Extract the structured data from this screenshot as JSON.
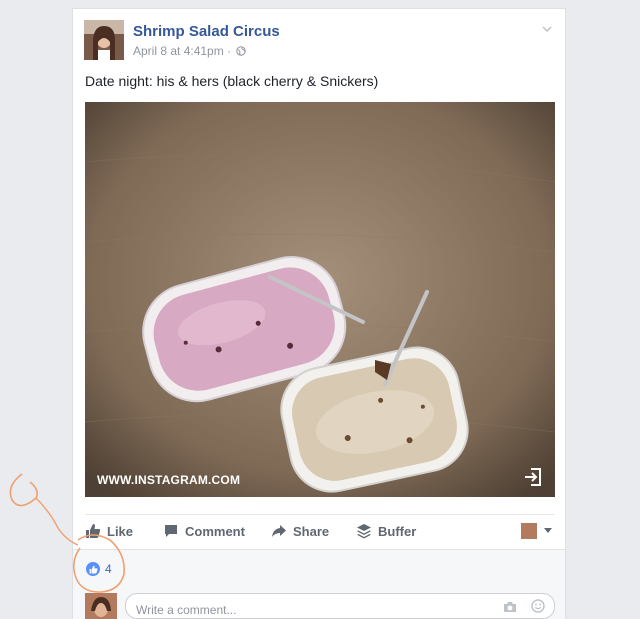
{
  "post": {
    "page_name": "Shrimp Salad Circus",
    "timestamp": "April 8 at 4:41pm",
    "separator": "·",
    "text": "Date night: his & hers (black cherry & Snickers)"
  },
  "photo": {
    "source": "WWW.INSTAGRAM.COM"
  },
  "actions": {
    "like_label": "Like",
    "comment_label": "Comment",
    "share_label": "Share",
    "buffer_label": "Buffer"
  },
  "reactions": {
    "like_count": "4"
  },
  "comment": {
    "placeholder": "Write a comment..."
  },
  "colors": {
    "brand_blue": "#365899",
    "like_blue": "#5890ff",
    "annotation_orange": "#f0a070"
  },
  "icons": [
    "globe-icon",
    "chevron-down-icon",
    "exit-icon",
    "thumbs-up-icon",
    "comment-icon",
    "share-icon",
    "buffer-icon",
    "camera-icon",
    "emoji-icon"
  ]
}
